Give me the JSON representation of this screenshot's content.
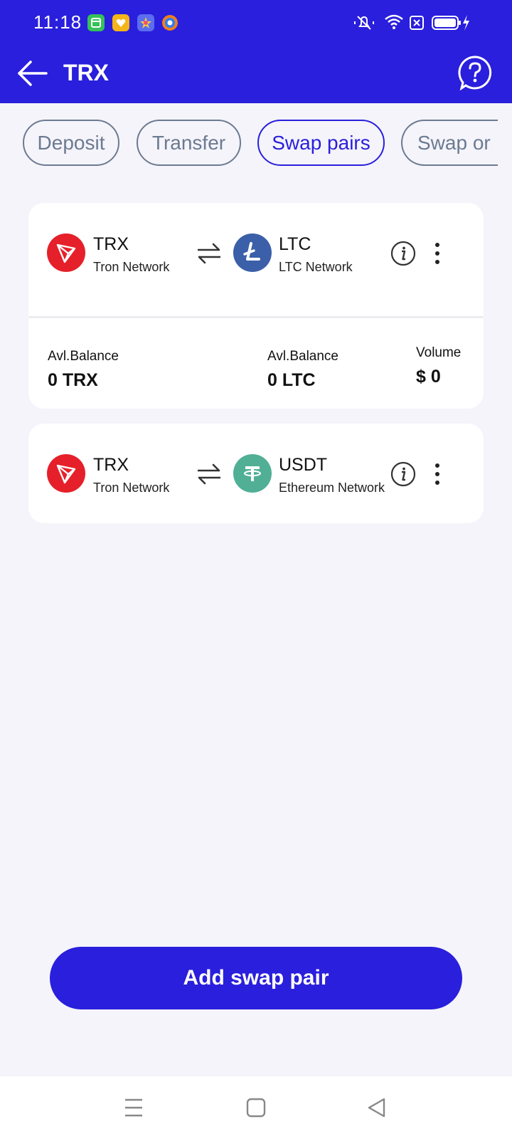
{
  "status_bar": {
    "time": "11:18",
    "app_icons": [
      "calendar-app-icon",
      "heart-app-icon",
      "star-app-icon",
      "browser-app-icon"
    ],
    "right_icons": [
      "silent-icon",
      "wifi-icon",
      "sim-x-icon",
      "battery-charging-icon"
    ]
  },
  "app_bar": {
    "title": "TRX",
    "back_icon": "arrow-left-icon",
    "help_icon": "help-question-icon"
  },
  "tabs": [
    {
      "label": "Deposit",
      "active": false
    },
    {
      "label": "Transfer",
      "active": false
    },
    {
      "label": "Swap pairs",
      "active": true
    },
    {
      "label": "Swap or",
      "active": false
    }
  ],
  "pairs": [
    {
      "from": {
        "symbol": "TRX",
        "network": "Tron Network",
        "color": "#e5202a"
      },
      "to": {
        "symbol": "LTC",
        "network": "LTC Network",
        "color": "#3b5fa8"
      },
      "expanded": true,
      "balances": {
        "from_label": "Avl.Balance",
        "from_value": "0 TRX",
        "to_label": "Avl.Balance",
        "to_value": "0 LTC",
        "volume_label": "Volume",
        "volume_value": "$ 0"
      }
    },
    {
      "from": {
        "symbol": "TRX",
        "network": "Tron Network",
        "color": "#e5202a"
      },
      "to": {
        "symbol": "USDT",
        "network": "Ethereum Network",
        "color": "#50af95"
      },
      "expanded": false
    }
  ],
  "add_button": {
    "label": "Add swap pair"
  },
  "colors": {
    "primary": "#2a1fdc",
    "background": "#f4f4fa",
    "tab_inactive": "#6c7a91"
  },
  "nav_bar": [
    "menu-icon",
    "home-square-icon",
    "back-triangle-icon"
  ]
}
